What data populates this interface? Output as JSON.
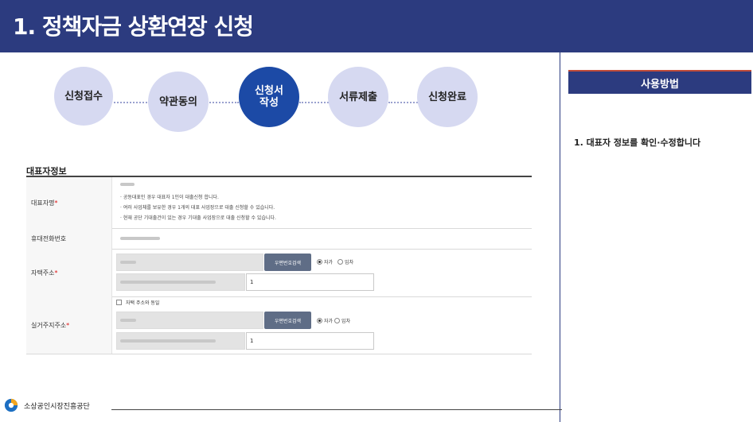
{
  "header": {
    "title": "1. 정책자금 상환연장 신청"
  },
  "steps": [
    {
      "label": "신청접수",
      "active": false
    },
    {
      "label": "약관동의",
      "active": false
    },
    {
      "label": "신청서\n작성",
      "active": true
    },
    {
      "label": "서류제출",
      "active": false
    },
    {
      "label": "신청완료",
      "active": false
    }
  ],
  "form": {
    "section_title": "대표자정보",
    "representative": {
      "label": "대표자명",
      "required_mark": "*",
      "notes": [
        "· 공동대표인 경우 대표자 1인이 대출신청 합니다.",
        "· 여러 사업체를 보유한 경우 1개의 대표 사업장으로 대출 신청할 수 있습니다.",
        "· 현재 공단 기대출건이 있는 경우 기대출 사업장으로 대출 신청할 수 있습니다."
      ]
    },
    "mobile": {
      "label": "휴대전화번호"
    },
    "home_address": {
      "label": "자택주소",
      "required_mark": "*",
      "search_button": "우편번호검색",
      "radio_own": "자가",
      "radio_rent": "임차",
      "detail_value": "1"
    },
    "residence_address": {
      "label": "실거주지주소",
      "required_mark": "*",
      "same_as_home": "자택 주소와 동일",
      "search_button": "우편번호검색",
      "radio_own": "자가",
      "radio_rent": "임차",
      "detail_value": "1"
    }
  },
  "sidebar": {
    "title": "사용방법",
    "items": [
      "1. 대표자 정보를 확인·수정합니다"
    ]
  },
  "footer": {
    "org_name": "소상공인시장진흥공단"
  },
  "colors": {
    "navy": "#2c3b7f",
    "active_step": "#1c4aa6",
    "step": "#d6d9f1",
    "button": "#5f6d86",
    "accent": "#c14c3a"
  }
}
